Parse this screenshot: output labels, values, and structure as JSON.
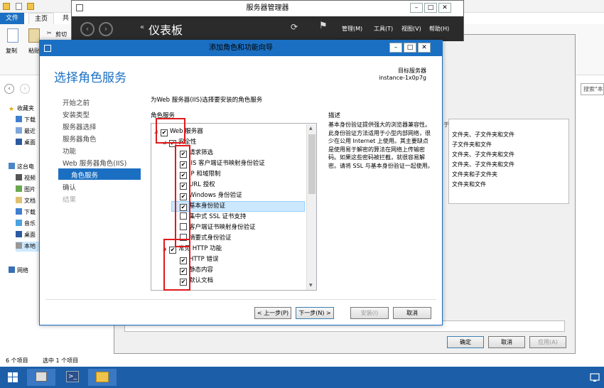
{
  "explorer": {
    "tabs": [
      "文件",
      "主页",
      "共"
    ],
    "ribbon": {
      "copy": "复制",
      "paste": "粘贴",
      "cut": "剪切"
    },
    "search_placeholder": "搜索\"本",
    "nav": [
      {
        "icon": "star-icon",
        "label": "收藏夹"
      },
      {
        "icon": "download-icon",
        "label": "下载"
      },
      {
        "icon": "recent-icon",
        "label": "最近"
      },
      {
        "icon": "desktop-icon",
        "label": "桌面"
      },
      {
        "icon": "computer-icon",
        "label": "这台电"
      },
      {
        "icon": "video-icon",
        "label": "视频"
      },
      {
        "icon": "picture-icon",
        "label": "图片"
      },
      {
        "icon": "document-icon",
        "label": "文档"
      },
      {
        "icon": "download-icon",
        "label": "下载"
      },
      {
        "icon": "music-icon",
        "label": "音乐"
      },
      {
        "icon": "desktop-icon",
        "label": "桌面"
      },
      {
        "icon": "disk-icon",
        "label": "本地"
      },
      {
        "icon": "network-icon",
        "label": "网络"
      }
    ],
    "status_items": "6 个项目",
    "status_selected": "选中 1 个项目"
  },
  "server_manager": {
    "title": "服务器管理器",
    "dashboard": "仪表板",
    "menu": [
      "管理(M)",
      "工具(T)",
      "视图(V)",
      "帮助(H)"
    ]
  },
  "props_dialog": {
    "rows": [
      "于",
      "文件夹、子文件夹和文件",
      "子文件夹和文件",
      "文件夹、子文件夹和文件",
      "文件夹、子文件夹和文件",
      "文件夹和子文件夹",
      "文件夹和文件"
    ],
    "ok": "确定",
    "cancel": "取消",
    "apply": "应用(A)"
  },
  "wizard": {
    "title": "添加角色和功能向导",
    "heading": "选择角色服务",
    "server_label": "目标服务器",
    "server_name": "instance-1x0p7g",
    "steps": [
      "开始之前",
      "安装类型",
      "服务器选择",
      "服务器角色",
      "功能",
      "Web 服务器角色(IIS)",
      "角色服务",
      "确认",
      "结果"
    ],
    "intro": "为Web 服务器(IIS)选择要安装的角色服务",
    "roles_label": "角色服务",
    "desc_label": "描述",
    "description": "基本身份验证提供强大的浏览器兼容性。此身份验证方法适用于小型内部网络，很少在公用 Internet 上使用。其主要缺点是使用易于解密的算法在网络上传输密码。如果这些密码被拦截，就很容易解密。请将 SSL 与基本身份验证一起使用。",
    "tree": [
      {
        "label": "Web 服务器",
        "checked": true,
        "expanded": true
      },
      {
        "label": "安全性",
        "checked": true,
        "expanded": true
      },
      {
        "label": "请求筛选",
        "checked": true
      },
      {
        "label": "IIS 客户端证书映射身份验证",
        "checked": true
      },
      {
        "label": "IP 和域限制",
        "checked": true
      },
      {
        "label": "URL 授权",
        "checked": true
      },
      {
        "label": "Windows 身份验证",
        "checked": true
      },
      {
        "label": "基本身份验证",
        "checked": true
      },
      {
        "label": "集中式 SSL 证书支持",
        "checked": false
      },
      {
        "label": "客户端证书映射身份验证",
        "checked": false
      },
      {
        "label": "摘要式身份验证",
        "checked": false
      },
      {
        "label": "常见 HTTP 功能",
        "checked": true,
        "expanded": true
      },
      {
        "label": "HTTP 错误",
        "checked": true
      },
      {
        "label": "静态内容",
        "checked": true
      },
      {
        "label": "默认文档",
        "checked": true
      }
    ],
    "buttons": {
      "prev": "< 上一步(P)",
      "next": "下一步(N) >",
      "install": "安装(I)",
      "cancel": "取消"
    }
  },
  "colors": {
    "accent": "#1b6fc2",
    "highlight": "#e0191c",
    "taskbar": "#1c5ea8"
  }
}
